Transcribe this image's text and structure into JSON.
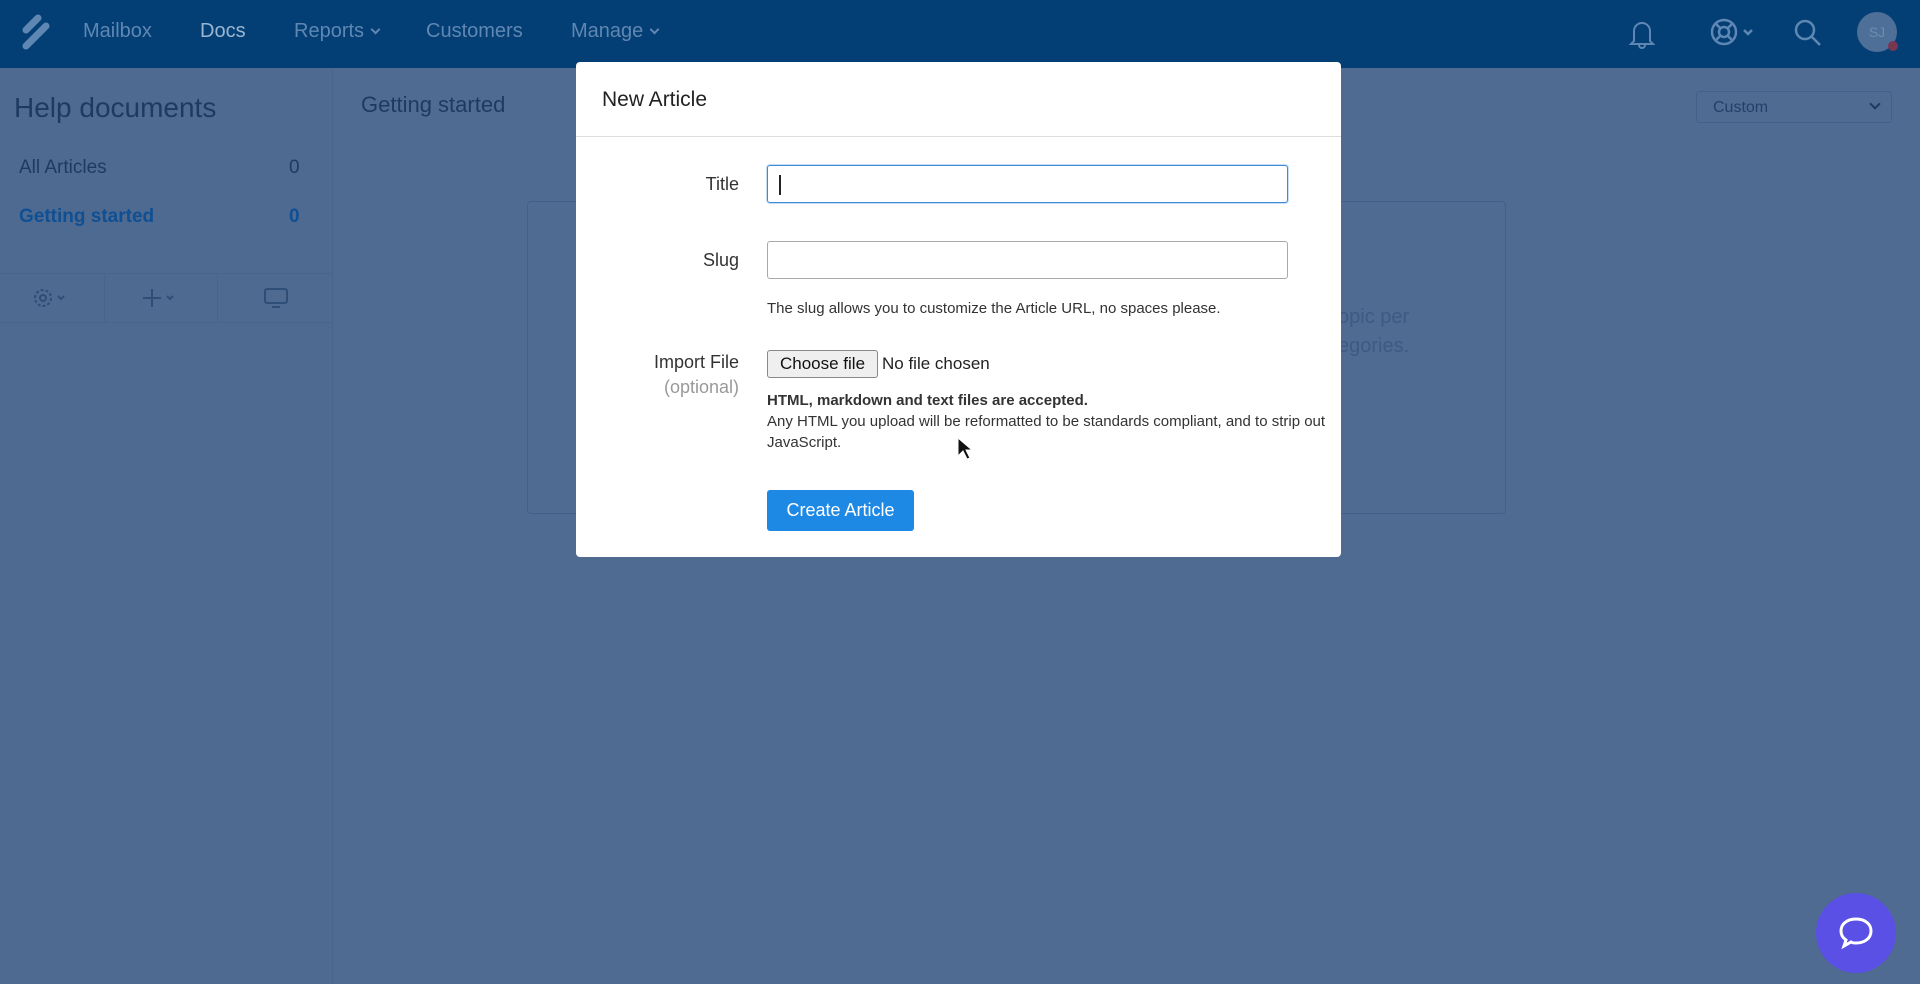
{
  "nav": {
    "items": [
      {
        "label": "Mailbox"
      },
      {
        "label": "Docs"
      },
      {
        "label": "Reports"
      },
      {
        "label": "Customers"
      },
      {
        "label": "Manage"
      }
    ],
    "avatar": "SJ"
  },
  "sidebar": {
    "title": "Help documents",
    "items": [
      {
        "label": "All Articles",
        "count": "0"
      },
      {
        "label": "Getting started",
        "count": "0"
      }
    ]
  },
  "main": {
    "title": "Getting started",
    "sort_select": "Custom",
    "card_line1": "opic per",
    "card_line2": "egories."
  },
  "modal": {
    "title": "New Article",
    "title_label": "Title",
    "title_value": "",
    "slug_label": "Slug",
    "slug_value": "",
    "slug_help": "The slug allows you to customize the Article URL, no spaces please.",
    "import_label": "Import File",
    "import_optional": "(optional)",
    "choose_file": "Choose file",
    "no_file": "No file chosen",
    "accepted": "HTML, markdown and text files are accepted.",
    "reformat_note": "Any HTML you upload will be reformatted to be standards compliant, and to strip out JavaScript.",
    "create_button": "Create Article"
  },
  "colors": {
    "nav": "#033f74",
    "accent": "#1e88e5",
    "chat": "#5b50e6"
  }
}
